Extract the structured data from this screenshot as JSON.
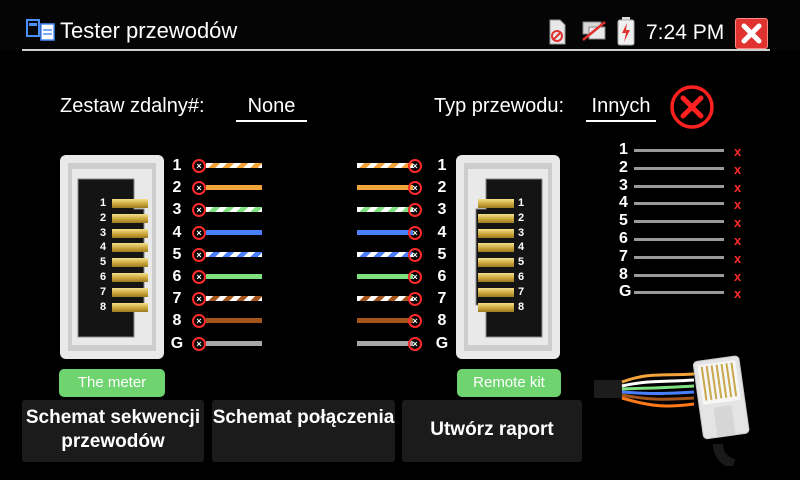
{
  "header": {
    "title": "Tester przewodów",
    "time": "7:24 PM"
  },
  "info": {
    "remote_label": "Zestaw zdalny#:",
    "remote_value": "None",
    "cable_label": "Typ przewodu:",
    "cable_value": "Innych"
  },
  "pins": [
    "1",
    "2",
    "3",
    "4",
    "5",
    "6",
    "7",
    "8"
  ],
  "wires": [
    {
      "label": "1",
      "color": "#f2a33a",
      "striped": true
    },
    {
      "label": "2",
      "color": "#f2a33a",
      "striped": false
    },
    {
      "label": "3",
      "color": "#7ee07e",
      "striped": true
    },
    {
      "label": "4",
      "color": "#4a7fff",
      "striped": false
    },
    {
      "label": "5",
      "color": "#4a7fff",
      "striped": true
    },
    {
      "label": "6",
      "color": "#7ee07e",
      "striped": false
    },
    {
      "label": "7",
      "color": "#a5551c",
      "striped": true
    },
    {
      "label": "8",
      "color": "#a5551c",
      "striped": false
    },
    {
      "label": "G",
      "color": "#a8a8a8",
      "striped": false
    }
  ],
  "results": {
    "labels": [
      "1",
      "2",
      "3",
      "4",
      "5",
      "6",
      "7",
      "8",
      "G"
    ],
    "mark": "x"
  },
  "tags": {
    "meter": "The meter",
    "remote": "Remote kit"
  },
  "buttons": {
    "sequence": "Schemat sekwencji przewodów",
    "connection": "Schemat połączenia",
    "report": "Utwórz raport"
  },
  "icons": {
    "app": "cable-tester-icon",
    "sd": "sd-card-icon",
    "network": "network-disconnected-icon",
    "battery": "battery-charging-icon",
    "close": "close-icon",
    "status": "error-circle-icon"
  },
  "colors": {
    "accent_red": "#ff2a2a",
    "tag_green": "#6fd36f",
    "button_bg": "#1b1b1b"
  }
}
